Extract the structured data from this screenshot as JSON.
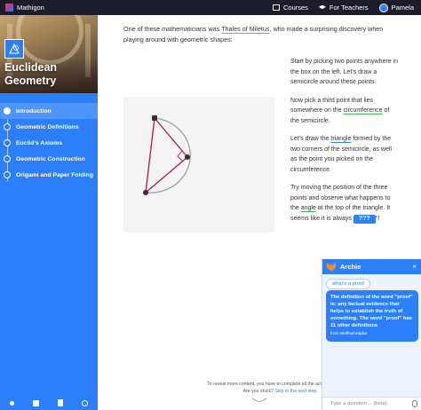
{
  "topbar": {
    "brand": "Mathigon",
    "courses": "Courses",
    "teachers": "For Teachers",
    "user": "Pamela"
  },
  "sidebar": {
    "course_title_line1": "Euclidean",
    "course_title_line2": "Geometry",
    "items": [
      {
        "label": "Introduction"
      },
      {
        "label": "Geometric Definitions"
      },
      {
        "label": "Euclid’s Axioms"
      },
      {
        "label": "Geometric Construction"
      },
      {
        "label": "Origami and Paper Folding"
      }
    ]
  },
  "content": {
    "intro_before": "One of these mathematicians was ",
    "intro_link": "Thales of Miletus",
    "intro_after": ", who made a surprising discovery when playing around with geometric shapes:",
    "p1": "Start by picking two points anywhere in the box on the left. Let’s draw a semicircle around these points.",
    "p2_before": "Now pick a third point that lies somewhere on the ",
    "p2_link": "circumference",
    "p2_after": " of the semicircle.",
    "p3_before": "Let’s draw the ",
    "p3_link": "triangle",
    "p3_after": " formed by the two corners of the semicircle, as well as the point you picked on the circumference.",
    "p4_before": "Try moving the position of the three points and observe what happens to the ",
    "p4_link": "angle",
    "p4_after": " at the top of the triangle. It seems like it is always ",
    "p4_blank": "???",
    "p4_end": "°!",
    "locked_line1": "To reveal more content, you have to complete all the activities and exer",
    "locked_line2_before": "Are you stuck? ",
    "locked_skip": "Skip to the next step"
  },
  "chat": {
    "title": "Archie",
    "close": "×",
    "user_msg": "what's a proof",
    "bot_msg": "The definition of the word \"proof\" is: any factual evidence that helps to establish the truth of something. The word \"proof\" has 11 other definitions",
    "source": "from WolframAlpha",
    "input_placeholder": "Type a question… (beta)"
  },
  "colors": {
    "topbar": "#1c1c2b",
    "accent": "#2d7ff9",
    "triangle": "#b0145a",
    "semicircle": "#9a9aa0"
  }
}
